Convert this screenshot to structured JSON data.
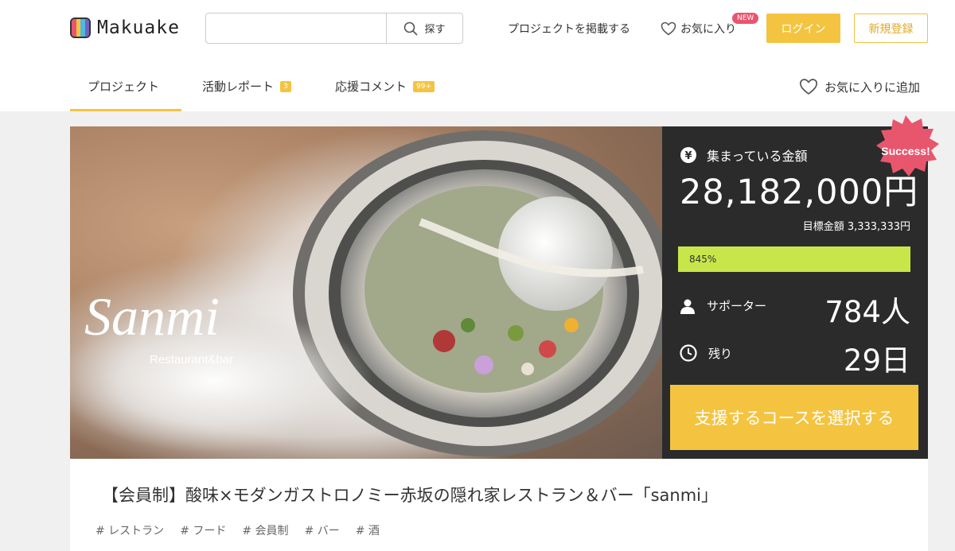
{
  "header": {
    "logo_text": "Makuake",
    "logo_colors": [
      "#e8566e",
      "#f4c440",
      "#4fb9e0",
      "#6f64c0"
    ],
    "search_placeholder": "",
    "search_button": "探す",
    "post_project": "プロジェクトを掲載する",
    "favorites": "お気に入り",
    "new_badge": "NEW",
    "login": "ログイン",
    "signup": "新規登録"
  },
  "tabs": [
    {
      "label": "プロジェクト",
      "count": ""
    },
    {
      "label": "活動レポート",
      "count": "3"
    },
    {
      "label": "応援コメント",
      "count": "99+"
    }
  ],
  "add_favorite": "お気に入りに追加",
  "hero": {
    "brand_script": "Sanmi",
    "brand_sub": "Restaurant&bar"
  },
  "stats": {
    "success_badge": "Success!",
    "collected_label": "集まっている金額",
    "collected_amount": "28,182,000円",
    "goal_text": "目標金額 3,333,333円",
    "percent_text": "845%",
    "progress_fraction": 1,
    "supporters_label": "サポーター",
    "supporters_value": "784人",
    "remaining_label": "残り",
    "remaining_value": "29日",
    "cta_button": "支援するコースを選択する"
  },
  "project": {
    "title": "【会員制】酸味×モダンガストロノミー赤坂の隠れ家レストラン＆バー「sanmi」",
    "tags": [
      "# レストラン",
      "# フード",
      "# 会員制",
      "# バー",
      "# 酒"
    ]
  },
  "colors": {
    "accent": "#f4c440",
    "progress": "#c8e64a",
    "success": "#e8566e",
    "panel": "#2b2b2b"
  }
}
